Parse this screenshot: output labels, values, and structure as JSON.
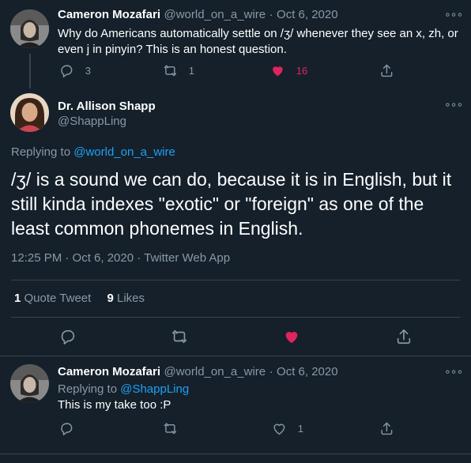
{
  "tweet1": {
    "name": "Cameron Mozafari",
    "handle": "@world_on_a_wire",
    "sep": "·",
    "date": "Oct 6, 2020",
    "text_line1": "Why do Americans automatically settle on /ʒ/ whenever they see an x, zh, or",
    "text_line2": "even j in pinyin? This is an honest question.",
    "replies": "3",
    "retweets": "1",
    "likes": "16"
  },
  "main_tweet": {
    "name": "Dr. Allison Shapp",
    "handle": "@ShappLing",
    "replying_to_label": "Replying to",
    "replying_to_handle": "@world_on_a_wire",
    "text_line1": "/ʒ/ is a sound we can do, because it is in English, but it",
    "text_line2": "still kinda indexes \"exotic\" or \"foreign\" as one of the",
    "text_line3": "least common phonemes in English.",
    "time": "12:25 PM · Oct 6, 2020 · Twitter Web App",
    "quote_count": "1",
    "quote_label": "Quote Tweet",
    "like_count": "9",
    "like_label": "Likes"
  },
  "tweet3": {
    "name": "Cameron Mozafari",
    "handle": "@world_on_a_wire",
    "sep": "·",
    "date": "Oct 6, 2020",
    "replying_to_label": "Replying to",
    "replying_to_handle": "@ShappLing",
    "text": "This is my take too :P",
    "likes": "1"
  },
  "more_glyph": "∘∘∘",
  "colors": {
    "background": "#15202b",
    "muted": "#8899a6",
    "link": "#1da1f2",
    "like": "#e0245e",
    "divider": "#38444d"
  },
  "icons": [
    "reply-icon",
    "retweet-icon",
    "like-icon",
    "share-icon",
    "more-icon"
  ]
}
